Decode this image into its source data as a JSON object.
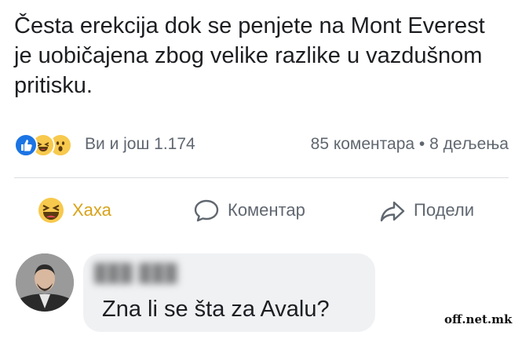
{
  "post": {
    "text": "Česta erekcija dok se penjete na Mont Everest je uobičajena zbog velike razlike u vazdušnom pritisku."
  },
  "reactions": {
    "icons": [
      "like-icon",
      "haha-icon",
      "wow-icon"
    ],
    "reactor_text": "Ви и још 1.174",
    "counts_text": "85 коментара • 8 дељења"
  },
  "actions": {
    "haha_label": "Хаха",
    "comment_label": "Коментар",
    "share_label": "Подели"
  },
  "comment": {
    "author": "███ ███",
    "text": "Zna li se šta za Avalu?"
  },
  "watermark": "off.net.mk",
  "colors": {
    "like_blue": "#1b74e4",
    "haha_yellow": "#f7c94d",
    "haha_label": "#d8a31a",
    "meta_gray": "#606770",
    "bubble_bg": "#eff1f3"
  }
}
